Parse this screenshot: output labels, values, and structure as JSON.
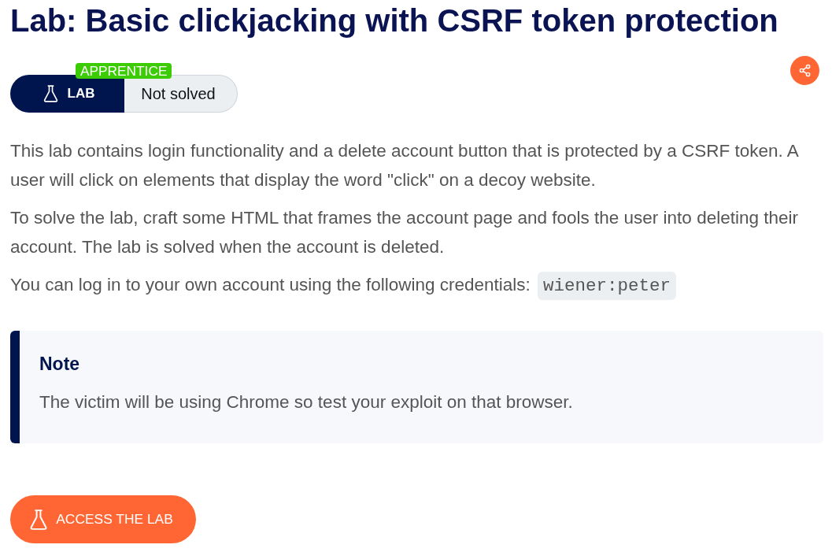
{
  "title": "Lab: Basic clickjacking with CSRF token protection",
  "lab_badge": {
    "label": "LAB",
    "level": "APPRENTICE",
    "status": "Not solved"
  },
  "description": [
    {
      "text": "This lab contains login functionality and a delete account button that is protected by a CSRF token. A user will click on elements that display the word \"click\" on a decoy website."
    },
    {
      "text": "To solve the lab, craft some HTML that frames the account page and fools the user into deleting their account. The lab is solved when the account is deleted."
    },
    {
      "text": "You can log in to your own account using the following credentials: ",
      "code": "wiener:peter"
    }
  ],
  "note": {
    "heading": "Note",
    "text": "The victim will be using Chrome so test your exploit on that browser."
  },
  "access_button": {
    "label": "ACCESS THE LAB"
  }
}
